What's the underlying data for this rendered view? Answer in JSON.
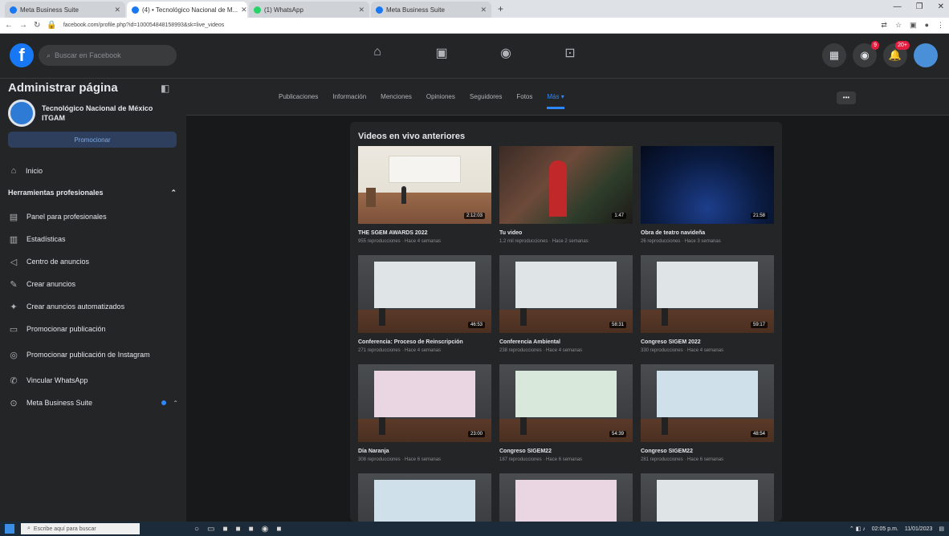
{
  "browser": {
    "tabs": [
      {
        "label": "Meta Business Suite",
        "active": false
      },
      {
        "label": "(4) • Tecnológico Nacional de M...",
        "active": true
      },
      {
        "label": "(1) WhatsApp",
        "active": false
      },
      {
        "label": "Meta Business Suite",
        "active": false
      }
    ],
    "url": "facebook.com/profile.php?id=100054848158993&sk=live_videos"
  },
  "topbar": {
    "search_placeholder": "Buscar en Facebook",
    "messenger_badge": "9",
    "notifications_badge": "20+"
  },
  "sidebar": {
    "title": "Administrar página",
    "page_name": "Tecnológico Nacional de México ITGAM",
    "promote_label": "Promocionar",
    "home_label": "Inicio",
    "section_title": "Herramientas profesionales",
    "items": [
      {
        "label": "Panel para profesionales",
        "icon": "dashboard-icon"
      },
      {
        "label": "Estadísticas",
        "icon": "stats-icon"
      },
      {
        "label": "Centro de anuncios",
        "icon": "megaphone-icon"
      },
      {
        "label": "Crear anuncios",
        "icon": "edit-icon"
      },
      {
        "label": "Crear anuncios automatizados",
        "icon": "sparkle-icon"
      },
      {
        "label": "Promocionar publicación",
        "icon": "promote-icon"
      },
      {
        "label": "Promocionar publicación de Instagram",
        "icon": "instagram-icon"
      },
      {
        "label": "Vincular WhatsApp",
        "icon": "whatsapp-icon"
      },
      {
        "label": "Meta Business Suite",
        "icon": "meta-icon"
      }
    ]
  },
  "page_tabs": [
    "Publicaciones",
    "Información",
    "Menciones",
    "Opiniones",
    "Seguidores",
    "Fotos",
    "Más ▾"
  ],
  "videos": {
    "title": "Videos en vivo anteriores",
    "items": [
      {
        "name": "THE SGEM AWARDS 2022",
        "meta": "955 reproducciones · Hace 4 semanas",
        "duration": "2:12:03",
        "thumb": "hall"
      },
      {
        "name": "Tu video",
        "meta": "1.2 mil reproducciones · Hace 2 semanas",
        "duration": "1:47",
        "thumb": "party"
      },
      {
        "name": "Obra de teatro navideña",
        "meta": "26 reproducciones · Hace 3 semanas",
        "duration": "21:58",
        "thumb": "stage"
      },
      {
        "name": "Conferencia: Proceso de Reinscripción",
        "meta": "271 reproducciones · Hace 4 semanas",
        "duration": "46:53",
        "thumb": "screen"
      },
      {
        "name": "Conferencia Ambiental",
        "meta": "238 reproducciones · Hace 4 semanas",
        "duration": "58:31",
        "thumb": "screen"
      },
      {
        "name": "Congreso SIGEM 2022",
        "meta": "330 reproducciones · Hace 4 semanas",
        "duration": "59:17",
        "thumb": "screen"
      },
      {
        "name": "Día Naranja",
        "meta": "308 reproducciones · Hace 6 semanas",
        "duration": "23:00",
        "thumb": "pink"
      },
      {
        "name": "Congreso SIGEM22",
        "meta": "187 reproducciones · Hace 6 semanas",
        "duration": "54:39",
        "thumb": "green"
      },
      {
        "name": "Congreso SIGEM22",
        "meta": "281 reproducciones · Hace 6 semanas",
        "duration": "48:54",
        "thumb": "blue"
      }
    ]
  },
  "taskbar": {
    "search_placeholder": "Escribe aquí para buscar",
    "clock": "02:05 p.m.",
    "date": "11/01/2023"
  }
}
